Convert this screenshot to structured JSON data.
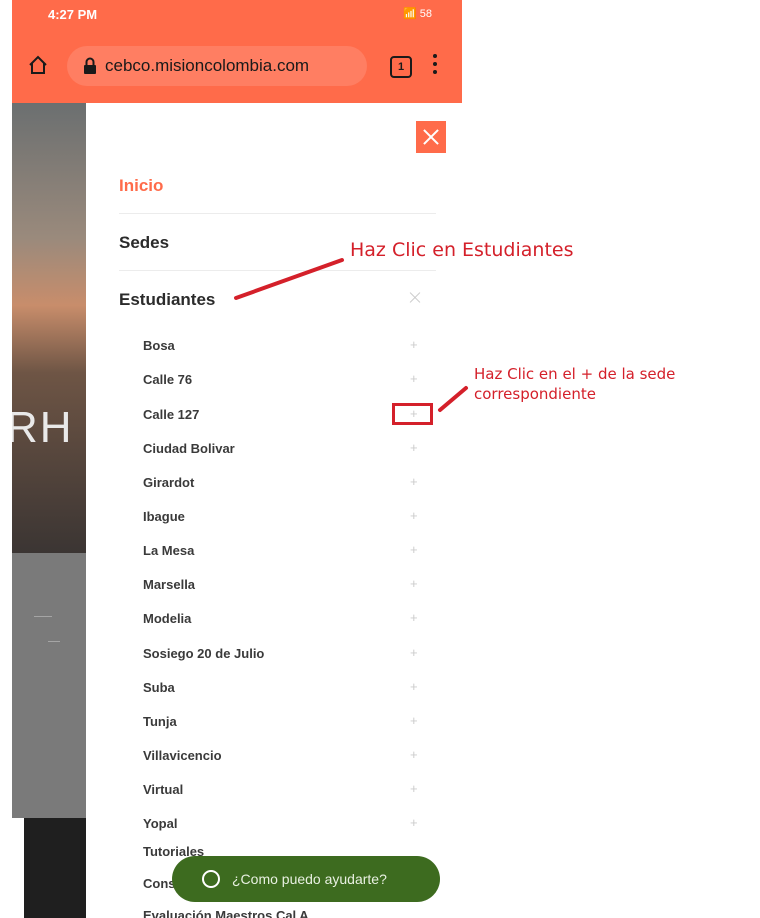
{
  "status_bar": {
    "time": "4:27 PM",
    "signal": "📶 58"
  },
  "browser": {
    "url": "cebco.misioncolombia.com",
    "tab_count": "1"
  },
  "background": {
    "hero_text": "RH"
  },
  "menu": {
    "items": [
      {
        "label": "Inicio"
      },
      {
        "label": "Sedes"
      },
      {
        "label": "Estudiantes"
      }
    ],
    "sub_items": [
      {
        "label": "Bosa"
      },
      {
        "label": "Calle 76"
      },
      {
        "label": "Calle 127"
      },
      {
        "label": "Ciudad Bolivar"
      },
      {
        "label": "Girardot"
      },
      {
        "label": "Ibague"
      },
      {
        "label": "La Mesa"
      },
      {
        "label": "Marsella"
      },
      {
        "label": "Modelia"
      },
      {
        "label": "Sosiego 20 de Julio"
      },
      {
        "label": "Suba"
      },
      {
        "label": "Tunja"
      },
      {
        "label": "Villavicencio"
      },
      {
        "label": "Virtual"
      },
      {
        "label": "Yopal"
      },
      {
        "label": "Tutoriales"
      },
      {
        "label": "Cons"
      },
      {
        "label": "Evaluación Maestros Cal A"
      }
    ],
    "plus_symbol": "+"
  },
  "whatsapp": {
    "label": "¿Como puedo ayudarte?"
  },
  "annotations": {
    "estudiantes": "Haz Clic en Estudiantes",
    "plus": "Haz Clic en el + de la sede correspondiente"
  },
  "colors": {
    "accent": "#ff6b4a",
    "annotation": "#d4202a",
    "whatsapp": "#3d6b1f"
  }
}
